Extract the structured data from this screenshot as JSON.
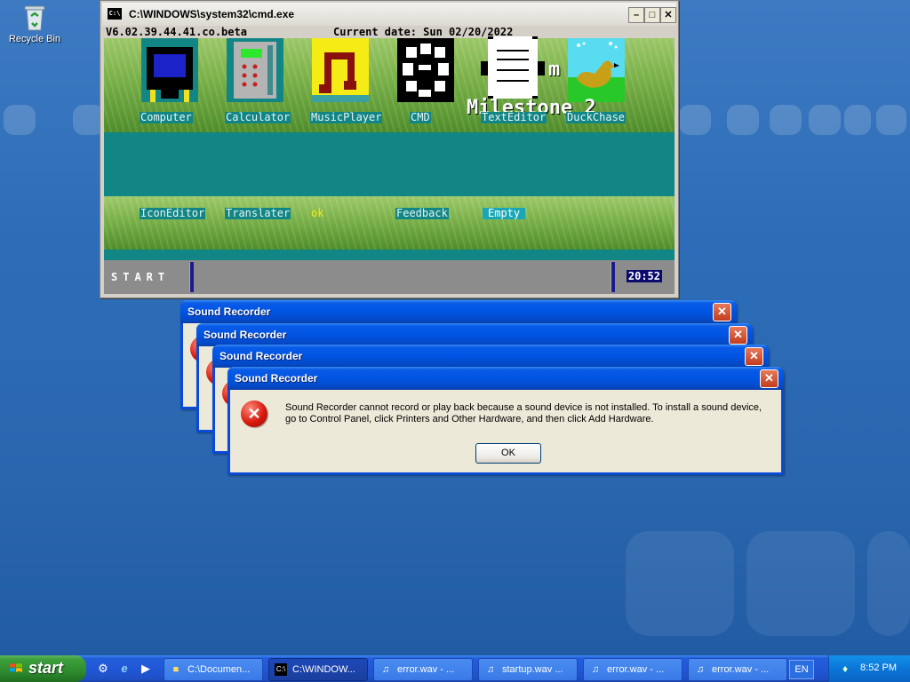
{
  "desktop": {
    "recycle_bin_label": "Recycle Bin"
  },
  "cmd_window": {
    "title": "C:\\WINDOWS\\system32\\cmd.exe",
    "title_icon": "C:\\",
    "version": "V6.02.39.44.41.co.beta",
    "current_date": "Current date: Sun 02/20/2022",
    "apps_row1": [
      {
        "label": "Computer",
        "icon": "computer-icon"
      },
      {
        "label": "Calculator",
        "icon": "calculator-icon"
      },
      {
        "label": "MusicPlayer",
        "icon": "music-player-icon"
      },
      {
        "label": "CMD",
        "icon": "cmd-icon"
      },
      {
        "label": "TextEditor",
        "icon": "text-editor-icon"
      },
      {
        "label": "DuckChase",
        "icon": "duck-icon"
      }
    ],
    "apps_row2": [
      {
        "label": "IconEditor"
      },
      {
        "label": "Translater"
      },
      {
        "label": "ok"
      },
      {
        "label": "Feedback"
      },
      {
        "label": "Empty"
      }
    ],
    "milestone_text": "Milestone 2",
    "start_label": "START",
    "clock": "20:52"
  },
  "dialogs": [
    {
      "title": "Sound Recorder"
    },
    {
      "title": "Sound Recorder"
    },
    {
      "title": "Sound Recorder"
    },
    {
      "title": "Sound Recorder",
      "message": "Sound Recorder cannot record or play back because a sound device is not installed. To install a sound device, go to Control Panel, click Printers and Other Hardware, and then click Add Hardware.",
      "ok_label": "OK"
    }
  ],
  "taskbar": {
    "start_label": "start",
    "buttons": [
      {
        "label": "C:\\Documen...",
        "icon": "folder-icon",
        "active": false
      },
      {
        "label": "C:\\WINDOW...",
        "icon": "cmd-icon",
        "active": true
      },
      {
        "label": "error.wav - ...",
        "icon": "sound-icon",
        "active": false
      },
      {
        "label": "startup.wav ...",
        "icon": "sound-icon",
        "active": false
      },
      {
        "label": "error.wav - ...",
        "icon": "sound-icon",
        "active": false
      },
      {
        "label": "error.wav - ...",
        "icon": "sound-icon",
        "active": false
      }
    ],
    "language": "EN",
    "clock": "8:52 PM"
  },
  "colors": {
    "xp_title_blue": "#0054e3",
    "cmd_teal": "#128585",
    "start_green": "#3c9f3c",
    "error_red": "#d81a0e"
  }
}
